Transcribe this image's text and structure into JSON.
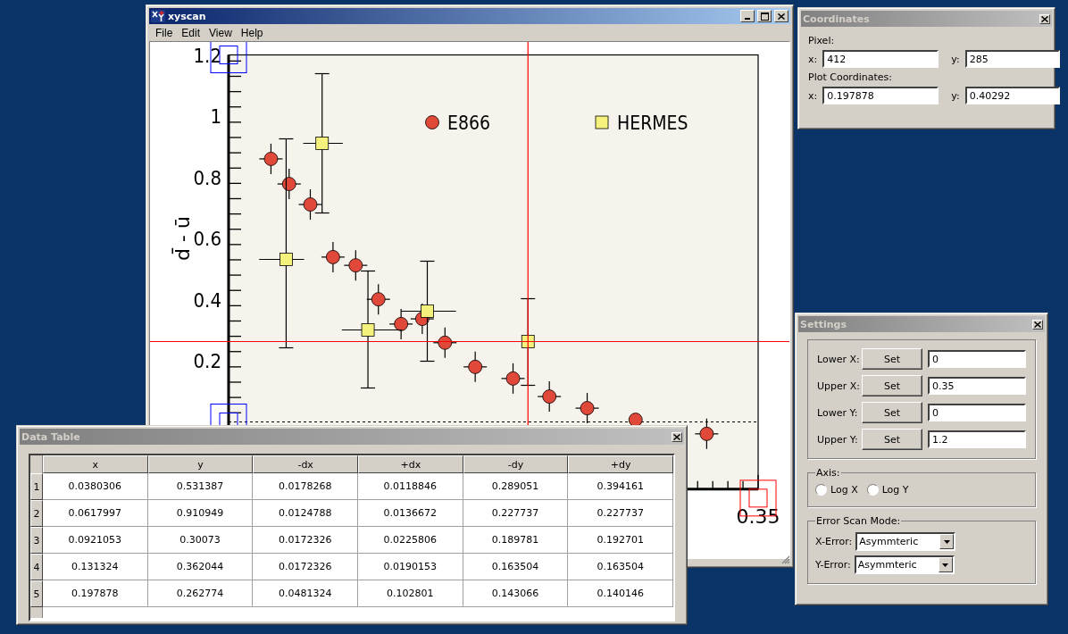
{
  "main_window": {
    "title": "xyscan",
    "active": true,
    "menu": [
      "File",
      "Edit",
      "View",
      "Help"
    ],
    "plot": {
      "y_axis_label": "d̄ - ū",
      "y_tick_labels": [
        "1.2",
        "1",
        "0.8",
        "0.6",
        "0.4",
        "0.2"
      ],
      "x_tick_label": "0.35",
      "legend": [
        {
          "label": "E866",
          "kind": "circle",
          "color": "#e0483a"
        },
        {
          "label": "HERMES",
          "kind": "square",
          "color": "#f4f27c"
        }
      ]
    }
  },
  "coordinates": {
    "title": "Coordinates",
    "active": false,
    "pixel_label": "Pixel:",
    "pixel_x": {
      "label": "x:",
      "value": "412"
    },
    "pixel_y": {
      "label": "y:",
      "value": "285"
    },
    "plot_label": "Plot Coordinates:",
    "plot_x": {
      "label": "x:",
      "value": "0.197878"
    },
    "plot_y": {
      "label": "y:",
      "value": "0.40292"
    }
  },
  "settings": {
    "title": "Settings",
    "active": false,
    "limits": [
      {
        "label": "Lower X:",
        "button": "Set",
        "value": "0"
      },
      {
        "label": "Upper X:",
        "button": "Set",
        "value": "0.35"
      },
      {
        "label": "Lower Y:",
        "button": "Set",
        "value": "0"
      },
      {
        "label": "Upper Y:",
        "button": "Set",
        "value": "1.2"
      }
    ],
    "axis": {
      "title": "Axis:",
      "options": [
        {
          "label": "Log X",
          "checked": false
        },
        {
          "label": "Log Y",
          "checked": false
        }
      ]
    },
    "error_mode": {
      "title": "Error Scan Mode:",
      "rows": [
        {
          "label": "X-Error:",
          "value": "Asymmteric"
        },
        {
          "label": "Y-Error:",
          "value": "Asymmteric"
        }
      ]
    }
  },
  "data_table": {
    "title": "Data Table",
    "active": false,
    "columns": [
      "x",
      "y",
      "-dx",
      "+dx",
      "-dy",
      "+dy"
    ],
    "rows": [
      {
        "header": "1",
        "cells": [
          "0.0380306",
          "0.531387",
          "0.0178268",
          "0.0118846",
          "0.289051",
          "0.394161"
        ]
      },
      {
        "header": "2",
        "cells": [
          "0.0617997",
          "0.910949",
          "0.0124788",
          "0.0136672",
          "0.227737",
          "0.227737"
        ]
      },
      {
        "header": "3",
        "cells": [
          "0.0921053",
          "0.30073",
          "0.0172326",
          "0.0225806",
          "0.189781",
          "0.192701"
        ]
      },
      {
        "header": "4",
        "cells": [
          "0.131324",
          "0.362044",
          "0.0172326",
          "0.0190153",
          "0.163504",
          "0.163504"
        ]
      },
      {
        "header": "5",
        "cells": [
          "0.197878",
          "0.262774",
          "0.0481324",
          "0.102801",
          "0.143066",
          "0.140146"
        ]
      }
    ]
  }
}
